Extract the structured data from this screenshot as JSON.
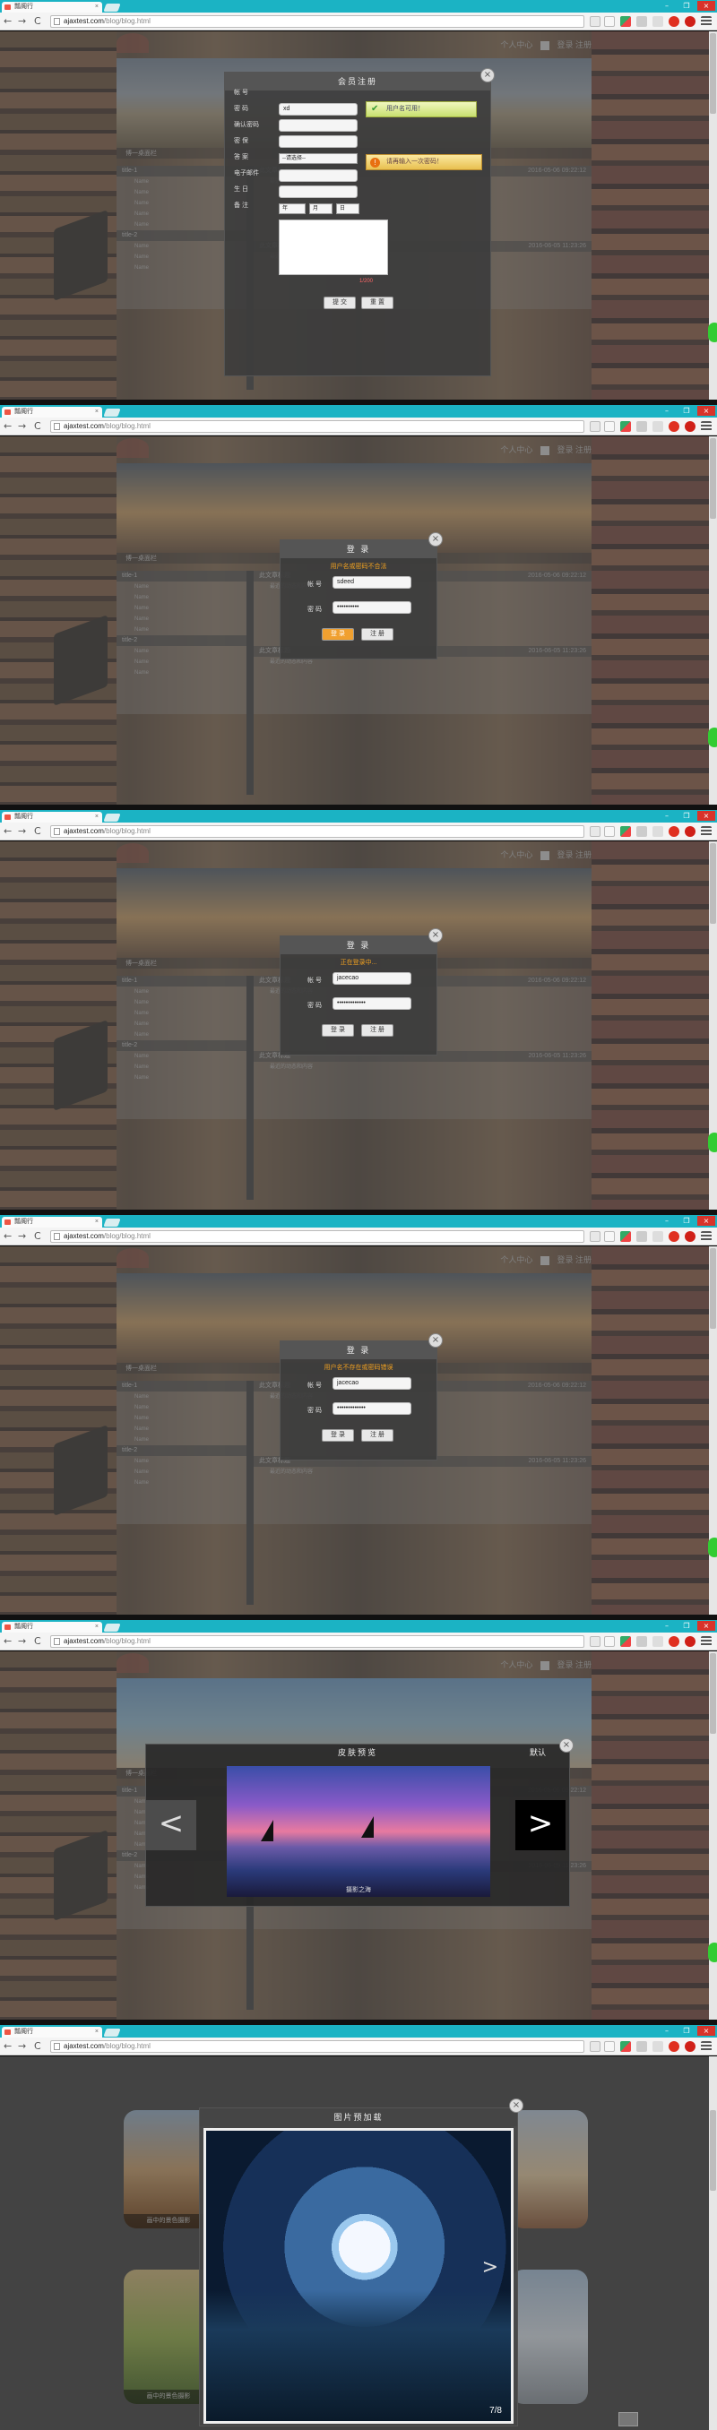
{
  "browser": {
    "tab_title": "瓢阁行",
    "tab_close": "×",
    "window_buttons": [
      "–",
      "❐",
      "×"
    ],
    "nav_back": "←",
    "nav_forward": "→",
    "nav_reload": "C",
    "url_domain": "ajaxtest.com",
    "url_path": "/blog/blog.html"
  },
  "page": {
    "user_center": "个人中心",
    "login_link": "登录",
    "register_link": "注册",
    "box_title": "博一桌面栏",
    "list_title": "title-1",
    "list_title_2": "title-2",
    "list_items": [
      "Name",
      "Name",
      "Name",
      "Name",
      "Name"
    ],
    "article_title": "此文章标题",
    "article_subtitle": "最近的动态和内容",
    "date_1": "2016-05-06 09:22:12",
    "date_2": "2016-06-05 11:23:26"
  },
  "frame1": {
    "modal_title": "会员注册",
    "close": "×",
    "labels": [
      "帐 号",
      "密 码",
      "确认密码",
      "密 保",
      "答 案",
      "电子邮件",
      "生 日",
      "备 注"
    ],
    "username_value": "xd",
    "select_placeholder": "--请选择--",
    "birthday_year": "年",
    "birthday_month": "月",
    "birthday_day": "日",
    "tip_ok": "用户名可用！",
    "tip_warn": "请再输入一次密码！",
    "submit": "提 交",
    "reset": "重 置",
    "counter_note": "1/200"
  },
  "frame2": {
    "modal_title": "登 录",
    "close": "×",
    "error": "用户名或密码不合法",
    "label_user": "帐 号",
    "label_pass": "密 码",
    "user_value": "sdeed",
    "pass_value": "••••••••••",
    "login_btn": "登 录",
    "register_btn": "注 册"
  },
  "frame3": {
    "modal_title": "登 录",
    "close": "×",
    "error": "正在登录中...",
    "label_user": "帐 号",
    "label_pass": "密 码",
    "user_value": "jacecao",
    "pass_value": "•••••••••••••",
    "login_btn": "登 录",
    "register_btn": "注 册"
  },
  "frame4": {
    "modal_title": "登 录",
    "close": "×",
    "error": "用户名不存在或密码错误",
    "label_user": "帐 号",
    "label_pass": "密 码",
    "user_value": "jacecao",
    "pass_value": "•••••••••••••",
    "login_btn": "登 录",
    "register_btn": "注 册"
  },
  "frame5": {
    "modal_title": "皮肤预览",
    "default_label": "默认",
    "close": "×",
    "prev": "<",
    "next": ">",
    "caption": "摄影之海"
  },
  "frame6": {
    "modal_title": "图片预加载",
    "close": "×",
    "counter": "7/8",
    "next_arrow": ">",
    "thumb_caption": "画中的景色摄影",
    "thumb_caption_2": "画中的景色摄影"
  },
  "colors": {
    "tabbar": "#1bb3c4",
    "tip_ok": "#c8e070",
    "tip_warn": "#e8c050",
    "error_text": "#f0a020"
  }
}
